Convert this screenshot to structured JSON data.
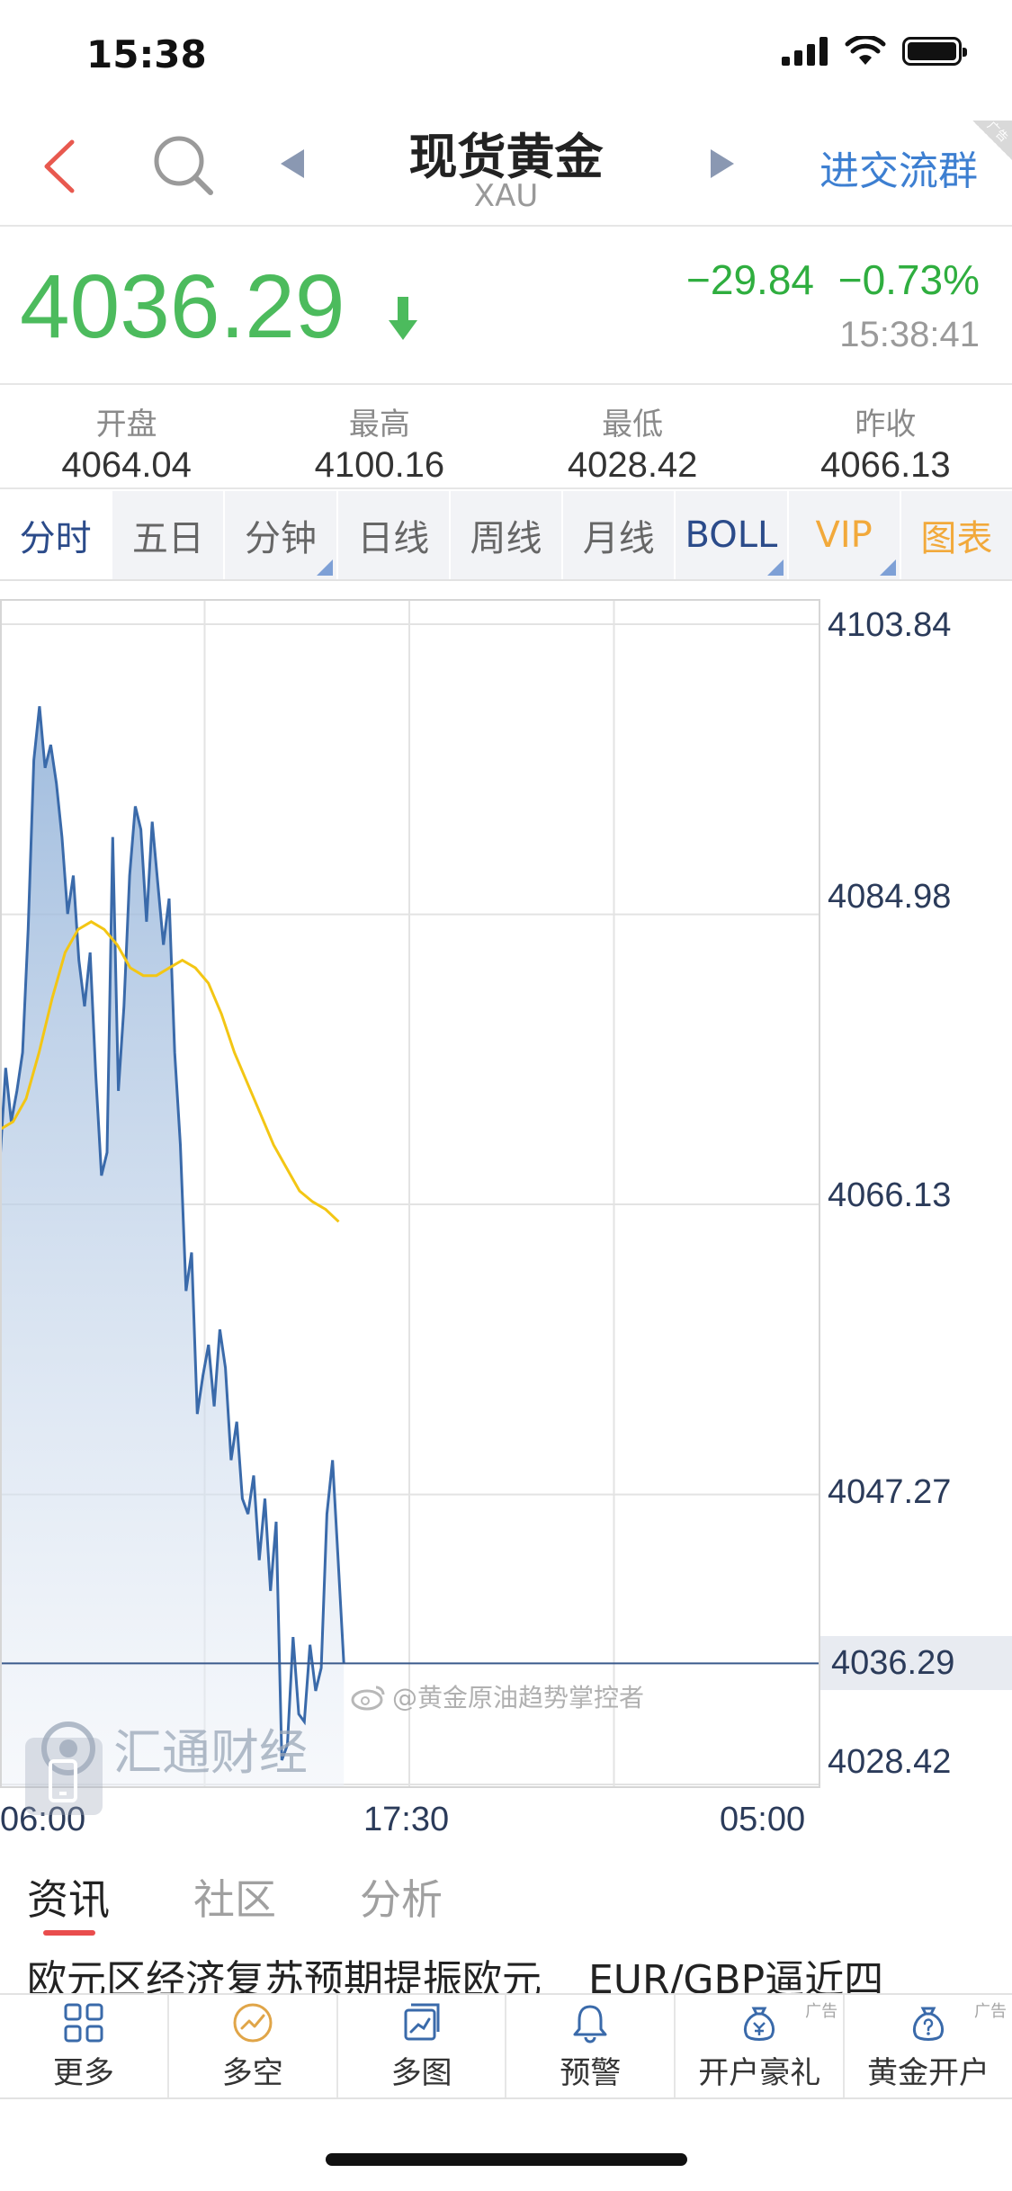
{
  "status_bar": {
    "time": "15:38"
  },
  "nav": {
    "title": "现货黄金",
    "subtitle": "XAU",
    "join_label": "进交流群",
    "ad_label": "广告"
  },
  "quote": {
    "price": "4036.29",
    "change": "−29.84",
    "change_pct": "−0.73%",
    "time": "15:38:41",
    "direction": "down",
    "colors": {
      "down": "#4cbb5d",
      "accent": "#3d7fd1"
    }
  },
  "stats": [
    {
      "label": "开盘",
      "value": "4064.04"
    },
    {
      "label": "最高",
      "value": "4100.16"
    },
    {
      "label": "最低",
      "value": "4028.42"
    },
    {
      "label": "昨收",
      "value": "4066.13"
    }
  ],
  "tabs": [
    {
      "label": "分时",
      "active": true
    },
    {
      "label": "五日"
    },
    {
      "label": "分钟"
    },
    {
      "label": "日线"
    },
    {
      "label": "周线"
    },
    {
      "label": "月线"
    },
    {
      "label": "BOLL"
    },
    {
      "label": "VIP"
    },
    {
      "label": "图表"
    }
  ],
  "chart_data": {
    "type": "line",
    "y_ticks": [
      "4103.84",
      "4084.98",
      "4066.13",
      "4047.27",
      "4028.42"
    ],
    "x_ticks": [
      "06:00",
      "17:30",
      "05:00"
    ],
    "current_price_label": "4036.29",
    "ylim": [
      4028.42,
      4103.84
    ],
    "session_fraction_elapsed": 0.42,
    "series": [
      {
        "role": "price",
        "color": "#3a6aaa",
        "values": [
          4069.0,
          4075.0,
          4071.5,
          4073.5,
          4076.0,
          4084.0,
          4095.0,
          4098.5,
          4094.5,
          4096.0,
          4093.5,
          4090.0,
          4085.0,
          4087.5,
          4082.0,
          4079.0,
          4082.5,
          4074.5,
          4068.0,
          4069.5,
          4090.0,
          4073.5,
          4079.0,
          4087.5,
          4092.0,
          4090.5,
          4084.5,
          4091.0,
          4087.0,
          4083.0,
          4086.0,
          4076.0,
          4070.0,
          4060.5,
          4063.0,
          4052.5,
          4055.0,
          4057.0,
          4053.0,
          4058.0,
          4055.5,
          4049.5,
          4052.0,
          4047.0,
          4046.0,
          4048.5,
          4043.0,
          4047.0,
          4041.0,
          4045.5,
          4030.0,
          4031.0,
          4038.0,
          4033.0,
          4032.5,
          4037.5,
          4034.5,
          4036.0,
          4046.0,
          4049.5,
          4043.0,
          4036.29
        ]
      },
      {
        "role": "average",
        "color": "#f3c614",
        "values": [
          4071.0,
          4071.5,
          4073.0,
          4076.0,
          4079.5,
          4082.5,
          4084.0,
          4084.5,
          4084.0,
          4083.0,
          4081.5,
          4081.0,
          4081.0,
          4081.5,
          4082.0,
          4081.5,
          4080.5,
          4078.5,
          4076.0,
          4074.0,
          4072.0,
          4070.0,
          4068.5,
          4067.0,
          4066.3,
          4065.8,
          4065.0
        ]
      }
    ]
  },
  "watermarks": {
    "weibo": "@黄金原油趋势掌控者",
    "brand": "汇通财经"
  },
  "news_tabs": [
    {
      "label": "资讯",
      "active": true
    },
    {
      "label": "社区"
    },
    {
      "label": "分析"
    }
  ],
  "news_headlines": [
    "欧元区经济复苏预期提振欧元",
    "EUR/GBP逼近四"
  ],
  "bottom_bar": [
    {
      "label": "更多",
      "icon": "grid-icon"
    },
    {
      "label": "多空",
      "icon": "trend-circle-icon"
    },
    {
      "label": "多图",
      "icon": "multi-chart-icon"
    },
    {
      "label": "预警",
      "icon": "bell-icon"
    },
    {
      "label": "开户豪礼",
      "icon": "money-bag-icon",
      "ad": "广告"
    },
    {
      "label": "黄金开户",
      "icon": "question-bag-icon",
      "ad": "广告"
    }
  ]
}
